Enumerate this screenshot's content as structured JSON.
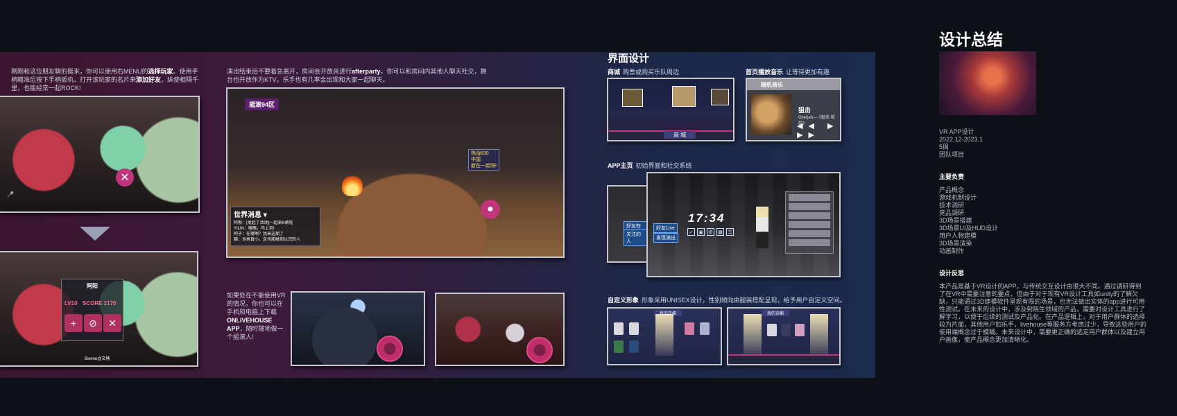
{
  "left": {
    "intro_text_a": "刚刚和这位朋友聊的挺来，你可以使用右MENU的",
    "intro_bold_1": "选择玩家",
    "intro_text_b": "。使用手柄瞄准后按下手柄扳机，打开该玩家的名片来",
    "intro_bold_2": "添加好友",
    "intro_text_c": "，纵使相隔千里，也能经常一起ROCK!",
    "card_name": "阿阳",
    "card_level": "LV10",
    "card_score": "SCORE 2170",
    "card_buttons": [
      "ADD",
      "BLOCK",
      "CLOSE"
    ],
    "watermark": "Bwenu@文楠"
  },
  "party": {
    "text_a": "演出结束后不要着急离开，房间会开放来进行",
    "text_bold": "afterparty",
    "text_b": "，你可以和房间内其他人聊天社交，舞台也开放作为KTV，乐手也有几率会出现和大家一起聊天。",
    "room_tag": "摇滚94区",
    "user_tag_lines": [
      "热战630",
      "中国",
      "新在一起呀!"
    ],
    "chat_title": "世界消息 ▾",
    "chat_lines": [
      "阿熊：[发起了活动]一起来K歌啦",
      "YILIN：嗷嗷，马上到!",
      "阿子：在哪啊？我来这期了",
      "猫：世界真小，这也能碰到认识的人"
    ]
  },
  "offline": {
    "text_a": "如果处在不能使用VR的情况，你也可以在手机和电脑上下载",
    "text_bold": "ONLIVEHOUSE APP",
    "text_b": "，随时随地做一个摇滚人!"
  },
  "ui": {
    "title": "界面设计",
    "shop_label": "商城",
    "shop_desc": "购票或购买乐队周边",
    "shop_button": "商 城",
    "music_label": "首页播放音乐",
    "music_desc": "让等待更加有趣",
    "music_header": "随机音乐",
    "music_song": "狙击",
    "music_artist": "Overjah—《狙击 前前》",
    "music_controls": "◀◀ ▶ ▶▶",
    "home_label": "APP主页",
    "home_desc": "初始界面和社交系统",
    "clock": "17:34",
    "home_tags": [
      "好友Live",
      "发现演出"
    ],
    "home_side_tags": [
      "好友在线",
      "关注的人"
    ],
    "avatar_label": "自定义形象",
    "avatar_desc": "形象采用UNISEX设计，性别倾向由服装搭配呈现，给予用户自定义空间。",
    "avatar_top": "我的衣橱",
    "avatar_top2": "我的衣橱"
  },
  "summary": {
    "title": "设计总结",
    "meta": [
      "VR APP设计",
      "2022.12-2023.1",
      "5周",
      "团队项目"
    ],
    "duties_title": "主要负责",
    "duties": [
      "产品概念",
      "游戏机制设计",
      "技术调研",
      "竞品调研",
      "3D场景搭建",
      "3D场景UI及HUD设计",
      "用户人物建模",
      "3D场景渲染",
      "动画制作"
    ],
    "reflection_title": "设计反思",
    "reflection": "本产品是基于VR设计的APP，与传统交互设计由很大不同。通过调研得到了在VR中需要注意的要点，但由于对于现有VR设计工具如unity的了解欠缺，只能通过3D建模软件呈现有限的场景，也无法做出实体的app进行可用性测试。在未来的设计中，涉及到陌生领域的产品，需要对设计工具进行了解学习，以便于后续的测试及产品化。在产品逻辑上，对于用户群体的选择较为片面，其他用户如乐手，livehouse等服务方考虑过少，导致这些用户的使用端概念过于模糊。未来设计中，需要更正确的选定用户群体以及建立用户画像，使产品概念更加清晰化。"
  }
}
